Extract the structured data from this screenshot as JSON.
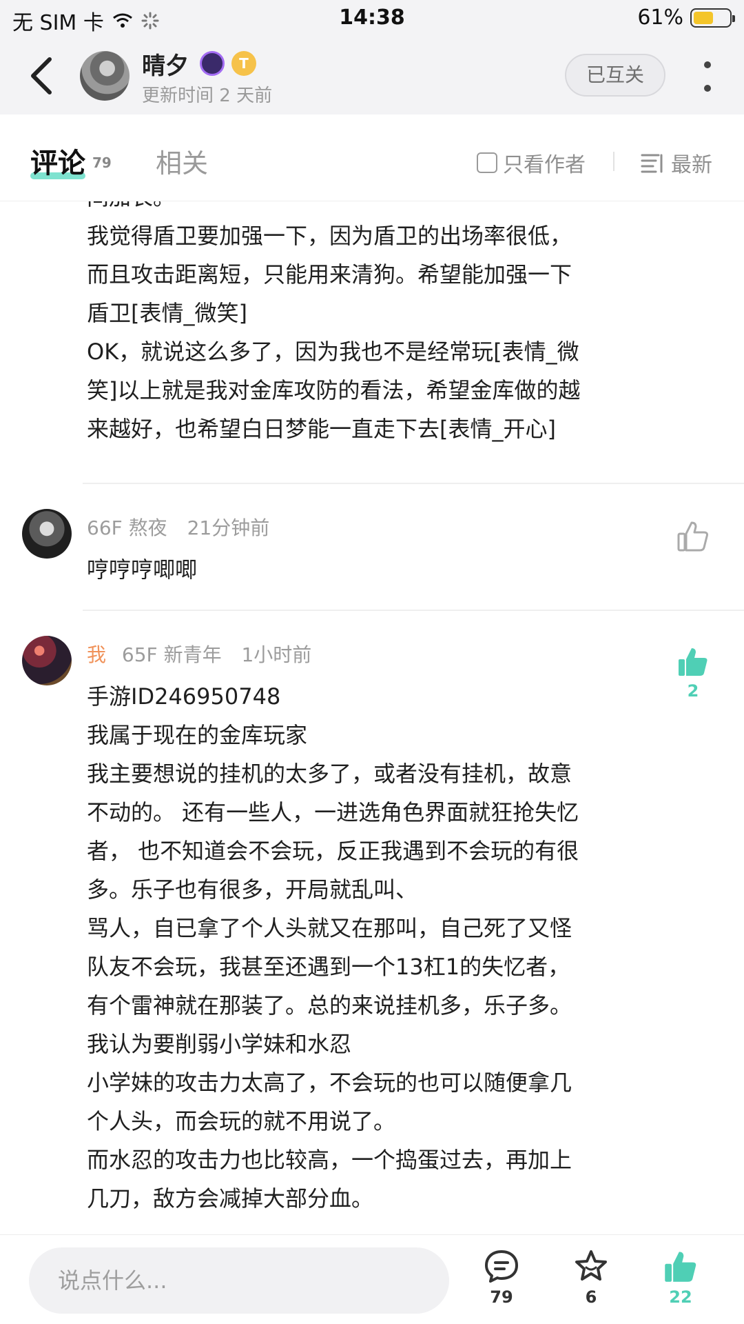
{
  "status_bar": {
    "carrier": "无 SIM 卡",
    "time": "14:38",
    "battery_percent": "61%",
    "battery_level": 0.61
  },
  "header": {
    "user_name": "晴夕",
    "badge_t": "T",
    "update_time": "更新时间 2 天前",
    "mutual_label": "已互关"
  },
  "tabs": {
    "comments_label": "评论",
    "comments_count": "79",
    "related_label": "相关",
    "only_author_label": "只看作者",
    "sort_label": "最新"
  },
  "comments": [
    {
      "lines": [
        "间加长。",
        "我觉得盾卫要加强一下，因为盾卫的出场率很低，",
        "而且攻击距离短，只能用来清狗。希望能加强一下",
        "盾卫[表情_微笑]",
        "OK，就说这么多了，因为我也不是经常玩[表情_微",
        "笑]以上就是我对金库攻防的看法，希望金库做的越",
        "来越好，也希望白日梦能一直走下去[表情_开心]"
      ]
    },
    {
      "floor": "66F",
      "name": "熬夜",
      "time": "21分钟前",
      "lines": [
        "哼哼哼唧唧"
      ]
    },
    {
      "me_label": "我",
      "floor": "65F",
      "name": "新青年",
      "time": "1小时前",
      "likes": "2",
      "lines": [
        "手游ID246950748",
        "我属于现在的金库玩家",
        "我主要想说的挂机的太多了，或者没有挂机，故意",
        "不动的。 还有一些人，一进选角色界面就狂抢失忆",
        "者， 也不知道会不会玩，反正我遇到不会玩的有很",
        "多。乐子也有很多，开局就乱叫、",
        "骂人，自已拿了个人头就又在那叫，自己死了又怪",
        "队友不会玩，我甚至还遇到一个13杠1的失忆者，",
        "有个雷神就在那装了。总的来说挂机多，乐子多。",
        "我认为要削弱小学妹和水忍",
        "小学妹的攻击力太高了，不会玩的也可以随便拿几",
        "个人头，而会玩的就不用说了。",
        "而水忍的攻击力也比较高，一个捣蛋过去，再加上",
        "几刀，敌方会减掉大部分血。"
      ]
    }
  ],
  "bottom_bar": {
    "input_placeholder": "说点什么...",
    "comment_count": "79",
    "favorite_count": "6",
    "like_count": "22"
  },
  "colors": {
    "accent": "#4fcfb5",
    "me_label": "#f0925a",
    "battery": "#f4c52a"
  }
}
